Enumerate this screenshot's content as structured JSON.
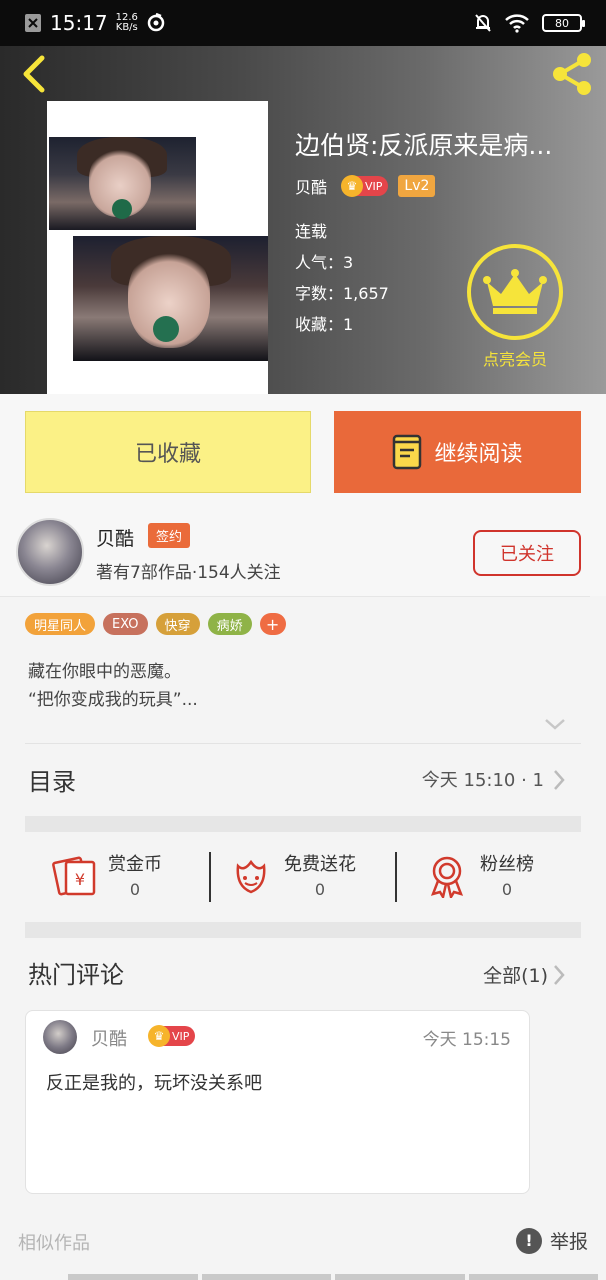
{
  "status_bar": {
    "time": "15:17",
    "net_speed_value": "12.6",
    "net_speed_unit": "KB/s",
    "battery": "80"
  },
  "book": {
    "title": "边伯贤:反派原来是病...",
    "author": "贝酷",
    "vip_label": "VIP",
    "level": "Lv2",
    "status": "连载",
    "popularity": "人气：3",
    "word_count": "字数：1,657",
    "favorites": "收藏：1",
    "member_label": "点亮会员"
  },
  "actions": {
    "collected_label": "已收藏",
    "continue_label": "继续阅读"
  },
  "author": {
    "name": "贝酷",
    "badge": "签约",
    "stats": "著有7部作品·154人关注",
    "follow_label": "已关注"
  },
  "tags": [
    {
      "label": "明星同人",
      "color": "#f2a23a"
    },
    {
      "label": "EXO",
      "color": "#c7715d"
    },
    {
      "label": "快穿",
      "color": "#d6a03a"
    },
    {
      "label": "病娇",
      "color": "#8fb347"
    },
    {
      "label": "+",
      "color": "#ef6c43"
    }
  ],
  "synopsis": {
    "line1": "藏在你眼中的恶魔。",
    "line2": "“把你变成我的玩具”..."
  },
  "toc": {
    "label": "目录",
    "update": "今天 15:10 · 1"
  },
  "rewards": [
    {
      "label": "赏金币",
      "count": "0",
      "icon": "coin-envelope-icon"
    },
    {
      "label": "免费送花",
      "count": "0",
      "icon": "flower-icon"
    },
    {
      "label": "粉丝榜",
      "count": "0",
      "icon": "medal-icon"
    }
  ],
  "comments": {
    "title": "热门评论",
    "all_label": "全部(1)",
    "items": [
      {
        "user": "贝酷",
        "vip": "VIP",
        "time": "今天 15:15",
        "text": "反正是我的，玩坏没关系吧"
      }
    ]
  },
  "footer": {
    "similar_label": "相似作品",
    "report_label": "举报",
    "report_icon_glyph": "!"
  },
  "colors": {
    "accent_orange": "#e9693a",
    "collected_yellow": "#fbf186",
    "crown_yellow": "#f6e43a",
    "follow_red": "#d0342c",
    "vip_red": "#e4454a"
  }
}
